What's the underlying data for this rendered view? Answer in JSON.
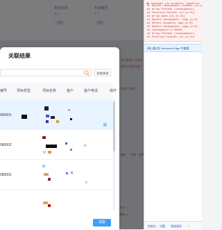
{
  "background": {
    "form_labels": [
      "机构名称",
      "科目编号"
    ],
    "form_values": [
      "¥ 0",
      "¥ 0"
    ],
    "chips": [
      "调整",
      "调整"
    ],
    "grid_columns": [
      "编码",
      "名称",
      "说明"
    ],
    "footer": [
      "合计: 0",
      "数量: 0"
    ],
    "red_notes": [
      "请完善客户信息后",
      "再提交审批流程",
      "数据不完整。"
    ]
  },
  "devtools": {
    "error_lines": [
      "▶ Uncaught (in promise) TypeError",
      "at Object.<anonymous> (vendor.js:1)",
      "at Array.forEach (<anonymous>)",
      "at Function.forEach (ui.js:21)",
      "at Array.each (ui.js:21)",
      "at Object.<anonymous> (app.js:8)",
      "at Object.dispatch (app.js:8)",
      "at Object.<anonymous> (app.js:9)",
      "at <anonymous>:1:39298",
      "at Array.forEach (<anonymous>)",
      "at Function.forEach (ui.js:21)",
      "at Array.each (ui.js:21)"
    ],
    "info": "[四] 通过在 Microsoft Edge 中查看",
    "bottom_tabs": [
      "控制台",
      "问题",
      "网络请求",
      "+"
    ]
  },
  "modal": {
    "title": "关联结果",
    "search_placeholder": "",
    "advanced_search": "高级搜索",
    "columns": [
      "编号",
      "项目类型",
      "项目名称",
      "客户",
      "客户电话",
      "操作"
    ],
    "rows": [
      {
        "code": "090001"
      },
      {
        "code": "080002"
      },
      {
        "code": "080001"
      }
    ],
    "confirm": "关联"
  },
  "colors": {
    "accent": "#409eff",
    "overlay": "rgba(0,0,0,0.48)",
    "selected_row": "#e8f4ff"
  }
}
